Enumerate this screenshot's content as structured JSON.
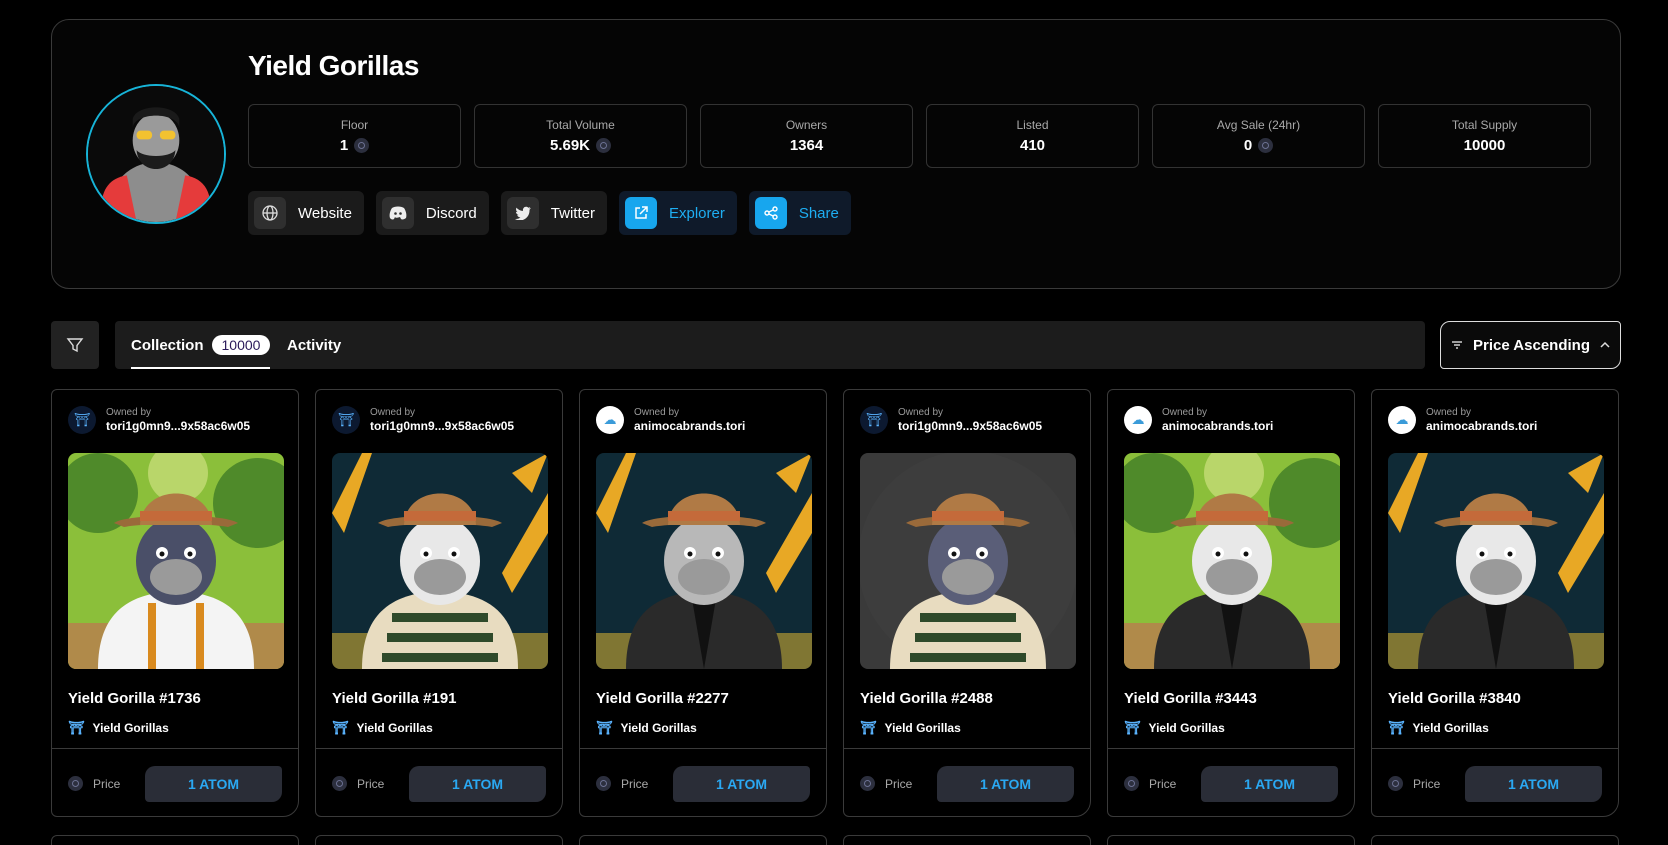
{
  "collection": {
    "title": "Yield Gorillas",
    "stats": [
      {
        "label": "Floor",
        "value": "1",
        "atom": true
      },
      {
        "label": "Total Volume",
        "value": "5.69K",
        "atom": true
      },
      {
        "label": "Owners",
        "value": "1364",
        "atom": false
      },
      {
        "label": "Listed",
        "value": "410",
        "atom": false
      },
      {
        "label": "Avg Sale (24hr)",
        "value": "0",
        "atom": true
      },
      {
        "label": "Total Supply",
        "value": "10000",
        "atom": false
      }
    ],
    "links": [
      {
        "label": "Website",
        "icon": "globe-icon",
        "accent": false
      },
      {
        "label": "Discord",
        "icon": "discord-icon",
        "accent": false
      },
      {
        "label": "Twitter",
        "icon": "twitter-icon",
        "accent": false
      },
      {
        "label": "Explorer",
        "icon": "external-link-icon",
        "accent": true
      },
      {
        "label": "Share",
        "icon": "share-icon",
        "accent": true
      }
    ]
  },
  "toolbar": {
    "tabs": [
      {
        "label": "Collection",
        "count": "10000",
        "active": true
      },
      {
        "label": "Activity",
        "active": false
      }
    ],
    "sort_label": "Price Ascending"
  },
  "cards": [
    {
      "owned_by_label": "Owned by",
      "owner": "tori1g0mn9...9x58ac6w05",
      "owner_icon": "tori",
      "name": "Yield Gorilla #1736",
      "collection": "Yield Gorillas",
      "price_label": "Price",
      "price": "1 ATOM",
      "bg": "forest",
      "fur": "#4a4f68",
      "outfit": "white"
    },
    {
      "owned_by_label": "Owned by",
      "owner": "tori1g0mn9...9x58ac6w05",
      "owner_icon": "tori",
      "name": "Yield Gorilla #191",
      "collection": "Yield Gorillas",
      "price_label": "Price",
      "price": "1 ATOM",
      "bg": "gold",
      "fur": "#e8e8e8",
      "outfit": "stripes"
    },
    {
      "owned_by_label": "Owned by",
      "owner": "animocabrands.tori",
      "owner_icon": "animoca",
      "name": "Yield Gorilla #2277",
      "collection": "Yield Gorillas",
      "price_label": "Price",
      "price": "1 ATOM",
      "bg": "gold",
      "fur": "#b8b8b8",
      "outfit": "jacket"
    },
    {
      "owned_by_label": "Owned by",
      "owner": "tori1g0mn9...9x58ac6w05",
      "owner_icon": "tori",
      "name": "Yield Gorilla #2488",
      "collection": "Yield Gorillas",
      "price_label": "Price",
      "price": "1 ATOM",
      "bg": "gray",
      "fur": "#5a5e78",
      "outfit": "stripes"
    },
    {
      "owned_by_label": "Owned by",
      "owner": "animocabrands.tori",
      "owner_icon": "animoca",
      "name": "Yield Gorilla #3443",
      "collection": "Yield Gorillas",
      "price_label": "Price",
      "price": "1 ATOM",
      "bg": "forest",
      "fur": "#e8e8e8",
      "outfit": "jacket"
    },
    {
      "owned_by_label": "Owned by",
      "owner": "animocabrands.tori",
      "owner_icon": "animoca",
      "name": "Yield Gorilla #3840",
      "collection": "Yield Gorillas",
      "price_label": "Price",
      "price": "1 ATOM",
      "bg": "gold",
      "fur": "#e8e8e8",
      "outfit": "jacket"
    }
  ],
  "colors": {
    "accent": "#1eaef2",
    "border": "#3a3a3a",
    "avatar_ring": "#17b4d8"
  }
}
